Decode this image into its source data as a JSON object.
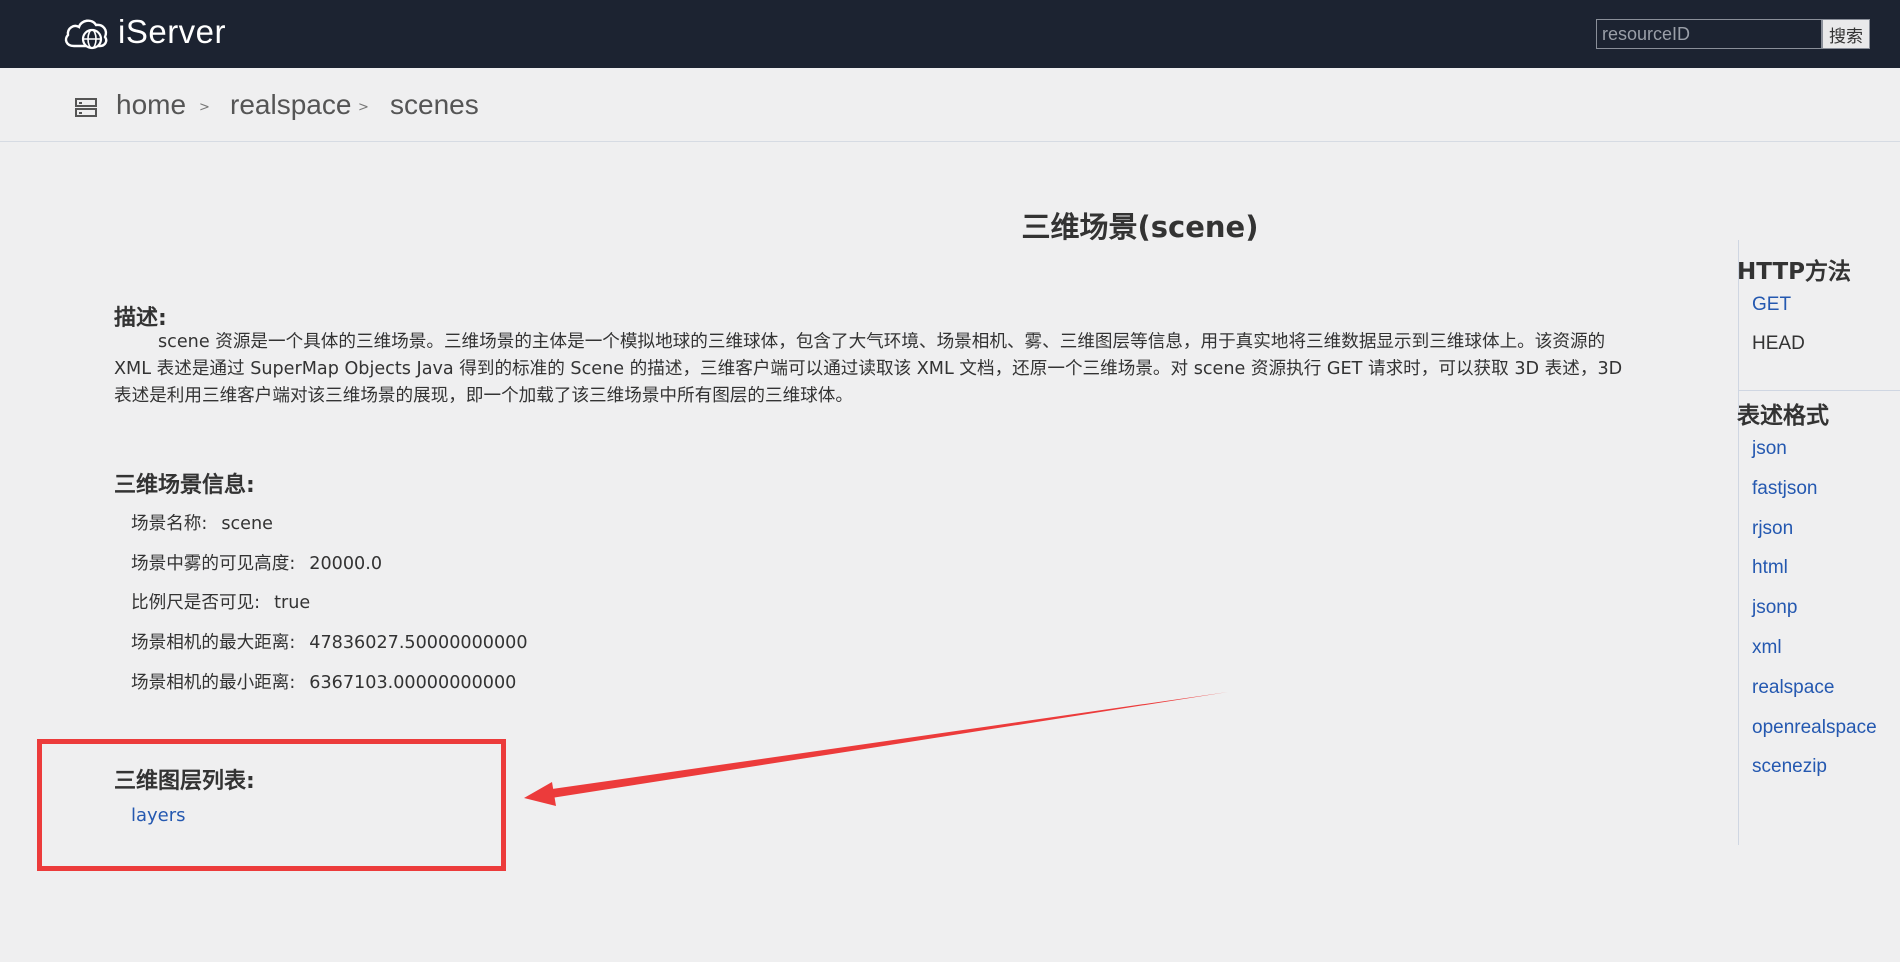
{
  "header": {
    "logo_text": "iServer",
    "search_placeholder": "resourceID",
    "search_button": "搜索"
  },
  "breadcrumb": [
    "home",
    "realspace",
    "scenes"
  ],
  "breadcrumb_separator": ">",
  "page_title": "三维场景(scene)",
  "description": {
    "heading": "描述:",
    "text": "scene 资源是一个具体的三维场景。三维场景的主体是一个模拟地球的三维球体，包含了大气环境、场景相机、雾、三维图层等信息，用于真实地将三维数据显示到三维球体上。该资源的 XML 表述是通过 SuperMap Objects Java 得到的标准的 Scene 的描述，三维客户端可以通过读取该 XML 文档，还原一个三维场景。对 scene 资源执行 GET 请求时，可以获取 3D 表述，3D 表述是利用三维客户端对该三维场景的展现，即一个加载了该三维场景中所有图层的三维球体。"
  },
  "scene_info": {
    "heading": "三维场景信息:",
    "rows": [
      {
        "label": "场景名称:",
        "value": "scene"
      },
      {
        "label": "场景中雾的可见高度:",
        "value": "20000.0"
      },
      {
        "label": "比例尺是否可见:",
        "value": "true"
      },
      {
        "label": "场景相机的最大距离:",
        "value": "47836027.50000000000"
      },
      {
        "label": "场景相机的最小距离:",
        "value": "6367103.00000000000"
      }
    ]
  },
  "layer_list": {
    "heading": "三维图层列表:",
    "link": "layers"
  },
  "sidebar": {
    "http_title": "HTTP方法",
    "http_methods": [
      "GET",
      "HEAD"
    ],
    "format_title": "表述格式",
    "formats": [
      "json",
      "fastjson",
      "rjson",
      "html",
      "jsonp",
      "xml",
      "realspace",
      "openrealspace",
      "scenezip"
    ]
  },
  "colors": {
    "topbar": "#1c2331",
    "link": "#2458b0",
    "annotation": "#ec3b3b"
  }
}
